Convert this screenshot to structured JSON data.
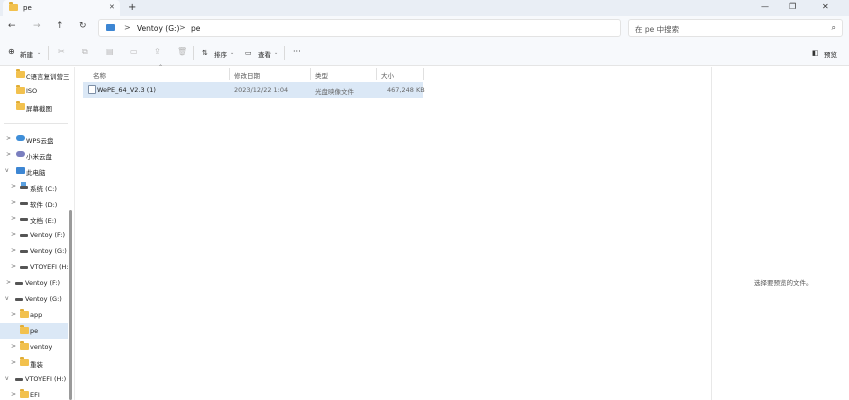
{
  "tab": {
    "title": "pe",
    "close_glyph": "✕"
  },
  "window": {
    "minimize": "—",
    "restore": "❐",
    "close": "✕",
    "new_tab": "+"
  },
  "nav": {
    "back": "←",
    "forward": "→",
    "up": "↑",
    "refresh": "↻"
  },
  "address": {
    "segments": [
      "Ventoy (G:)",
      "pe"
    ],
    "separator": ">"
  },
  "search": {
    "placeholder": "在 pe 中搜索",
    "icon": "search-icon"
  },
  "toolbar": {
    "new_label": "新建",
    "sort_label": "排序",
    "view_label": "查看",
    "more_label": "···",
    "preview_label": "预览",
    "icons": [
      "cut-icon",
      "copy-icon",
      "paste-icon",
      "rename-icon",
      "share-icon",
      "delete-icon"
    ]
  },
  "sidebar": {
    "items": [
      {
        "label": "C语言复训营三剑",
        "icon": "folder-icon",
        "chevron": ""
      },
      {
        "label": "ISO",
        "icon": "folder-icon",
        "chevron": ""
      },
      {
        "label": "屏幕截图",
        "icon": "folder-icon",
        "chevron": ""
      },
      {
        "label": "WPS云盘",
        "icon": "cloud-icon",
        "chevron": ">"
      },
      {
        "label": "小米云盘",
        "icon": "cloud-icon",
        "chevron": ">"
      },
      {
        "label": "此电脑",
        "icon": "computer-icon",
        "chevron": "v"
      },
      {
        "label": "系统 (C:)",
        "icon": "windows-drive-icon",
        "chevron": ">"
      },
      {
        "label": "软件 (D:)",
        "icon": "drive-icon",
        "chevron": ">"
      },
      {
        "label": "文档 (E:)",
        "icon": "drive-icon",
        "chevron": ">"
      },
      {
        "label": "Ventoy (F:)",
        "icon": "drive-icon",
        "chevron": ">"
      },
      {
        "label": "Ventoy (G:)",
        "icon": "drive-icon",
        "chevron": ">"
      },
      {
        "label": "VTOYEFI (H:)",
        "icon": "drive-icon",
        "chevron": ">"
      },
      {
        "label": "Ventoy (F:)",
        "icon": "drive-icon",
        "chevron": ">"
      },
      {
        "label": "Ventoy (G:)",
        "icon": "drive-icon",
        "chevron": "v"
      },
      {
        "label": "app",
        "icon": "folder-icon",
        "chevron": ">"
      },
      {
        "label": "pe",
        "icon": "folder-icon",
        "chevron": ""
      },
      {
        "label": "ventoy",
        "icon": "folder-icon",
        "chevron": ">"
      },
      {
        "label": "重装",
        "icon": "folder-icon",
        "chevron": ">"
      },
      {
        "label": "VTOYEFI (H:)",
        "icon": "drive-icon",
        "chevron": "v"
      },
      {
        "label": "EFI",
        "icon": "folder-icon",
        "chevron": ">"
      }
    ]
  },
  "columns": [
    "名称",
    "修改日期",
    "类型",
    "大小"
  ],
  "files": [
    {
      "name": "WePE_64_V2.3 (1)",
      "modified": "2023/12/22 1:04",
      "type": "光盘映像文件",
      "size": "467,248 KB"
    }
  ],
  "preview_pane": {
    "message": "选择要预览的文件。"
  }
}
